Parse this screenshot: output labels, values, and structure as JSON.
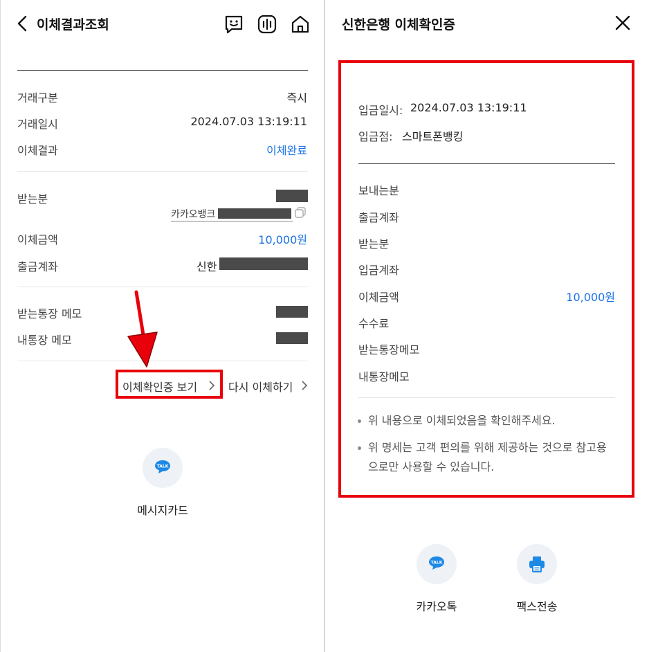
{
  "left": {
    "header": {
      "back_icon": "chevron-left-icon",
      "title": "이체결과조회",
      "icons": [
        "chat-smile-icon",
        "voice-bars-icon",
        "home-icon"
      ]
    },
    "info": {
      "type_label": "거래구분",
      "type_value": "즉시",
      "datetime_label": "거래일시",
      "datetime_value": "2024.07.03 13:19:11",
      "result_label": "이체결과",
      "result_value": "이체완료"
    },
    "recipient": {
      "label": "받는분",
      "bank_prefix": "카카오뱅크",
      "amount_label": "이체금액",
      "amount_value": "10,000원",
      "account_label": "출금계좌",
      "account_bank": "신한"
    },
    "memo": {
      "recipient_memo_label": "받는통장 메모",
      "my_memo_label": "내통장 메모"
    },
    "actions": {
      "view_certificate": "이체확인증 보기",
      "retry_transfer": "다시 이체하기"
    },
    "share": {
      "talk_badge": "TALK",
      "message_card": "메시지카드"
    }
  },
  "right": {
    "header": {
      "title": "신한은행 이체확인증",
      "close_icon": "close-icon"
    },
    "deposit": {
      "datetime_label": "입금일시:",
      "datetime_value": "2024.07.03 13:19:11",
      "branch_label": "입금점:",
      "branch_value": "스마트폰뱅킹"
    },
    "fields": [
      {
        "label": "보내는분",
        "value": ""
      },
      {
        "label": "출금계좌",
        "value": ""
      },
      {
        "label": "받는분",
        "value": ""
      },
      {
        "label": "입금계좌",
        "value": ""
      },
      {
        "label": "이체금액",
        "value": "10,000원"
      },
      {
        "label": "수수료",
        "value": ""
      },
      {
        "label": "받는통장메모",
        "value": ""
      },
      {
        "label": "내통장메모",
        "value": ""
      }
    ],
    "notes": [
      "위 내용으로 이체되었음을 확인해주세요.",
      "위 명세는 고객 편의를 위해 제공하는 것으로 참고용으로만 사용할 수 있습니다."
    ],
    "share": {
      "talk_badge": "TALK",
      "kakaotalk": "카카오톡",
      "fax": "팩스전송"
    }
  },
  "colors": {
    "accent_blue": "#1a73e8",
    "highlight_red": "#e8000b",
    "kakao_blue": "#1e88e5",
    "redaction": "#4a4a4a"
  }
}
